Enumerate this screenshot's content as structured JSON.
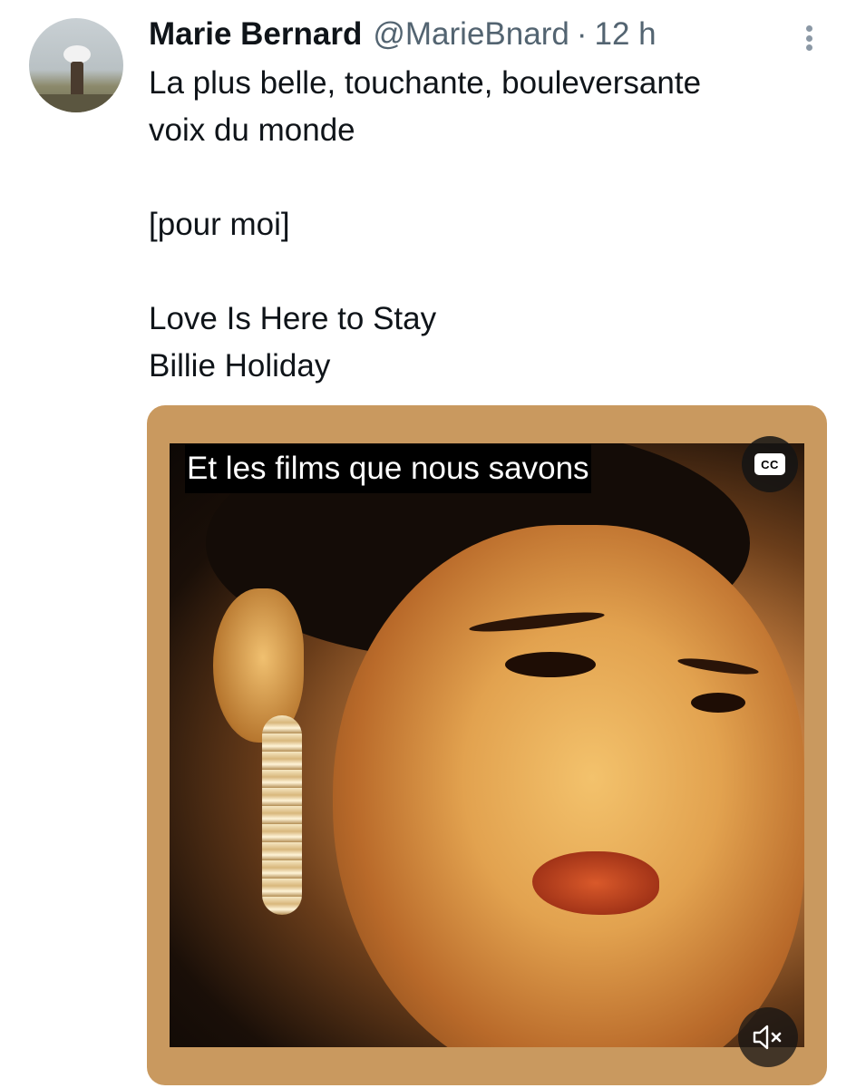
{
  "tweet": {
    "author_name": "Marie Bernard",
    "author_handle": "@MarieBnard",
    "separator": "·",
    "timestamp": "12 h",
    "text_lines": [
      "La plus belle, touchante, bouleversante",
      "voix du monde",
      "",
      "[pour moi]",
      "",
      "Love Is Here to Stay",
      "Billie Holiday"
    ]
  },
  "video": {
    "caption": "Et les films que nous savons",
    "cc_label": "CC",
    "muted": true
  },
  "icons": {
    "more": "more-vertical-icon",
    "cc": "closed-captions-icon",
    "mute": "volume-muted-icon"
  },
  "colors": {
    "text": "#0f1419",
    "secondary_text": "#536471",
    "media_frame": "#c9995f"
  }
}
